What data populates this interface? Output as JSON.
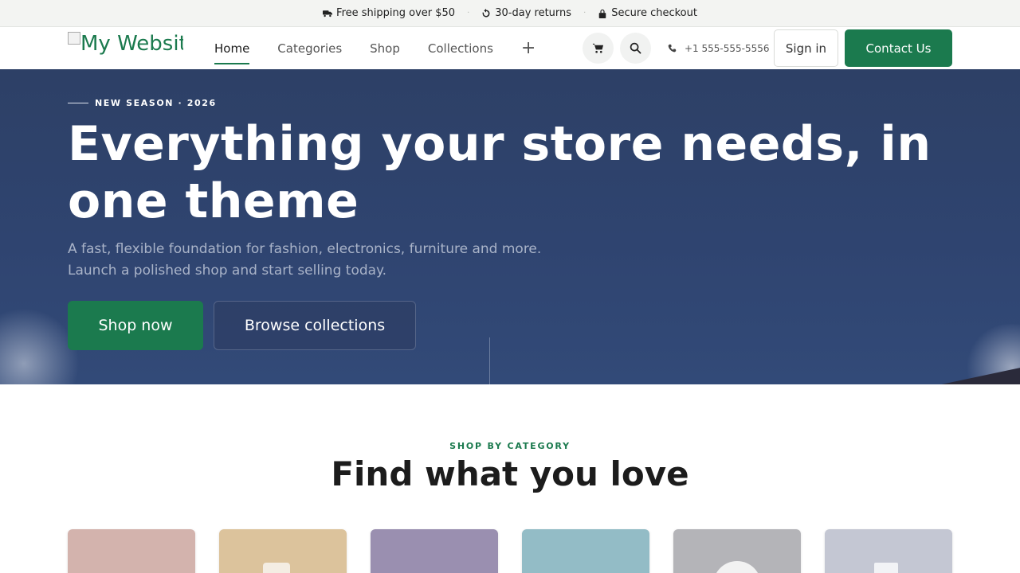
{
  "announcement": {
    "items": [
      {
        "icon": "truck-icon",
        "text": "Free shipping over $50"
      },
      {
        "icon": "refresh-icon",
        "text": "30-day returns"
      },
      {
        "icon": "lock-icon",
        "text": "Secure checkout"
      }
    ],
    "separator": "·"
  },
  "header": {
    "logo_alt": "My Websit",
    "nav": [
      {
        "label": "Home",
        "active": true
      },
      {
        "label": "Categories"
      },
      {
        "label": "Shop"
      },
      {
        "label": "Collections"
      }
    ],
    "more_label": "+",
    "cart_icon": "cart-icon",
    "search_icon": "search-icon",
    "phone_icon": "phone-icon",
    "phone": "+1 555-555-5556",
    "signin": "Sign in",
    "contact": "Contact Us"
  },
  "hero": {
    "eyebrow": "NEW SEASON · 2026",
    "title": "Everything your store needs, in one theme",
    "subtitle_line1": "A fast, flexible foundation for fashion, electronics, furniture and more.",
    "subtitle_line2": "Launch a polished shop and start selling today.",
    "primary_cta": "Shop now",
    "secondary_cta": "Browse collections"
  },
  "categories": {
    "eyebrow": "SHOP BY CATEGORY",
    "title": "Find what you love",
    "cards": [
      {
        "color": "#d3b3ad"
      },
      {
        "color": "#dcc39c"
      },
      {
        "color": "#9a8fb0"
      },
      {
        "color": "#93bcc6"
      },
      {
        "color": "#b4b4b8"
      },
      {
        "color": "#c4c7d3"
      }
    ]
  },
  "colors": {
    "brand": "#1b7a4e",
    "hero_bg": "#2f4470"
  }
}
